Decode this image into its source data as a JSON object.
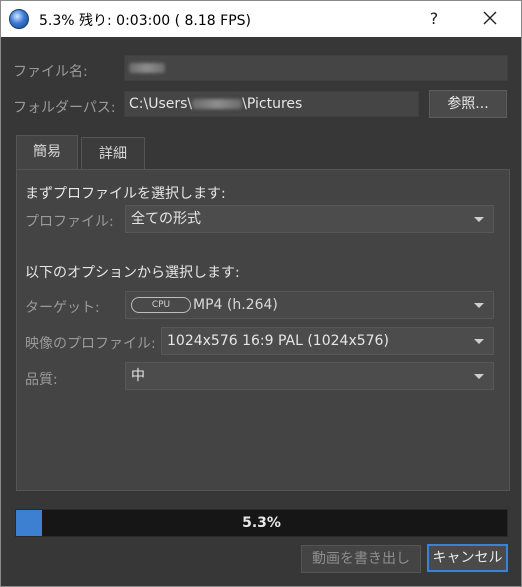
{
  "titlebar": {
    "title": "5.3%  残り: 0:03:00 ( 8.18 FPS)",
    "help_label": "?"
  },
  "file": {
    "filename_label": "ファイル名:",
    "folder_label": "フォルダーパス:",
    "folder_prefix": "C:\\Users\\",
    "folder_suffix": "\\Pictures",
    "browse_label": "参照..."
  },
  "tabs": [
    {
      "label": "簡易",
      "active": true
    },
    {
      "label": "詳細",
      "active": false
    }
  ],
  "simple": {
    "profile_heading": "まずプロファイルを選択します:",
    "profile_label": "プロファイル:",
    "profile_value": "全ての形式",
    "options_heading": "以下のオプションから選択します:",
    "target_label": "ターゲット:",
    "target_badge": "CPU",
    "target_value": "MP4 (h.264)",
    "video_profile_label": "映像のプロファイル:",
    "video_profile_value": "1024x576 16:9 PAL (1024x576)",
    "quality_label": "品質:",
    "quality_value": "中"
  },
  "progress": {
    "percent": 5.3,
    "text": "5.3%"
  },
  "footer": {
    "export_label": "動画を書き出し",
    "cancel_label": "キャンセル"
  },
  "colors": {
    "window_bg": "#373737",
    "panel_bg": "#444444",
    "accent": "#3d7fd1"
  }
}
